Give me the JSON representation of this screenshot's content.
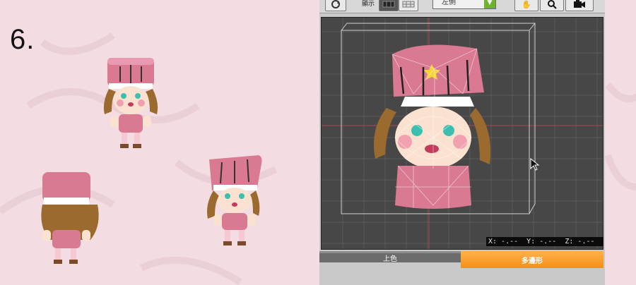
{
  "step": {
    "number": "6."
  },
  "editor": {
    "toolbar": {
      "display_label": "顯示",
      "view_select": "左側",
      "icons": [
        "rotate-view-icon",
        "solid-view-icon",
        "grid-view-icon",
        "hand-icon",
        "zoom-icon",
        "camera-icon"
      ]
    },
    "coord_readout": "X: -.--  Y: -.--  Z: -.--",
    "tabs": {
      "color": "上色",
      "polygon": "多邊形"
    }
  },
  "colors": {
    "background": "#f3dde3",
    "hat_pink": "#d97a92",
    "hair_brown": "#9b6a2e",
    "accent_orange": "#f58f16",
    "select_green": "#6cb52b"
  }
}
